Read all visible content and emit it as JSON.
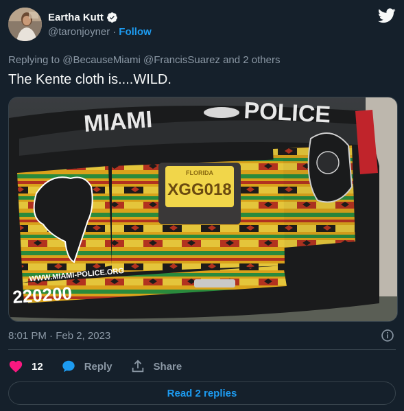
{
  "tweet": {
    "author": {
      "display_name": "Eartha Kutt",
      "handle": "@taronjoyner",
      "separator": "·",
      "follow_label": "Follow",
      "verified": true
    },
    "reply_context": "Replying to @BecauseMiami @FrancisSuarez and 2 others",
    "text": "The Kente cloth is....WILD.",
    "timestamp": "8:01 PM · Feb 2, 2023",
    "likes_count": "12",
    "reply_label": "Reply",
    "share_label": "Share",
    "read_replies_label": "Read 2 replies"
  },
  "media": {
    "lettering": {
      "top_left": "MIAMI",
      "top_right": "POLICE",
      "plate_state": "FLORIDA",
      "plate_number": "XGG018",
      "website": "WWW.MIAMI-POLICE.ORG",
      "unit_number": "220200"
    }
  },
  "colors": {
    "background": "#15202b",
    "primary_text": "#f7f9f9",
    "secondary_text": "#8b98a5",
    "accent": "#1d9bf0",
    "like": "#f91880",
    "border": "#38444d"
  },
  "icons": {
    "verified": "verified-badge-icon",
    "logo": "twitter-bird-icon",
    "info": "info-icon",
    "like": "heart-icon",
    "reply": "speech-bubble-icon",
    "share": "share-arrow-icon"
  }
}
